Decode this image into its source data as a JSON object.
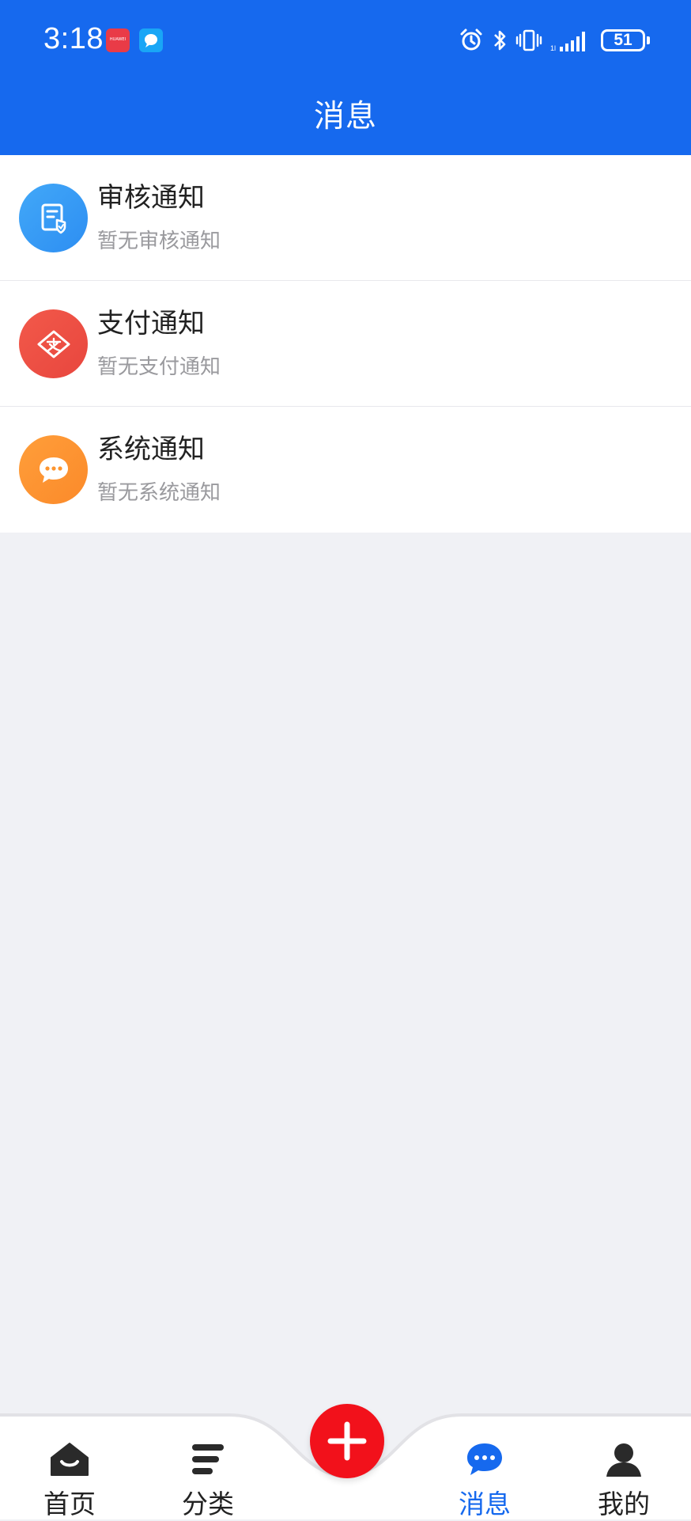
{
  "status_bar": {
    "time": "3:18",
    "battery": "51",
    "huawei_badge": "HUAWEI"
  },
  "header": {
    "title": "消息"
  },
  "notifications": [
    {
      "title": "审核通知",
      "subtitle": "暂无审核通知",
      "icon": "review-document-icon",
      "color": "#3A9DF6"
    },
    {
      "title": "支付通知",
      "subtitle": "暂无支付通知",
      "icon": "payment-icon",
      "color": "#EE4F43"
    },
    {
      "title": "系统通知",
      "subtitle": "暂无系统通知",
      "icon": "chat-bubble-icon",
      "color": "#FD952F"
    }
  ],
  "tabbar": {
    "tabs": [
      {
        "label": "首页",
        "icon": "home-icon",
        "active": false
      },
      {
        "label": "分类",
        "icon": "category-icon",
        "active": false
      },
      {
        "label": "消息",
        "icon": "message-icon",
        "active": true
      },
      {
        "label": "我的",
        "icon": "profile-icon",
        "active": false
      }
    ],
    "center_action": "add-icon"
  },
  "colors": {
    "primary": "#1669EE",
    "fab": "#F2111B",
    "background": "#F0F1F5"
  }
}
